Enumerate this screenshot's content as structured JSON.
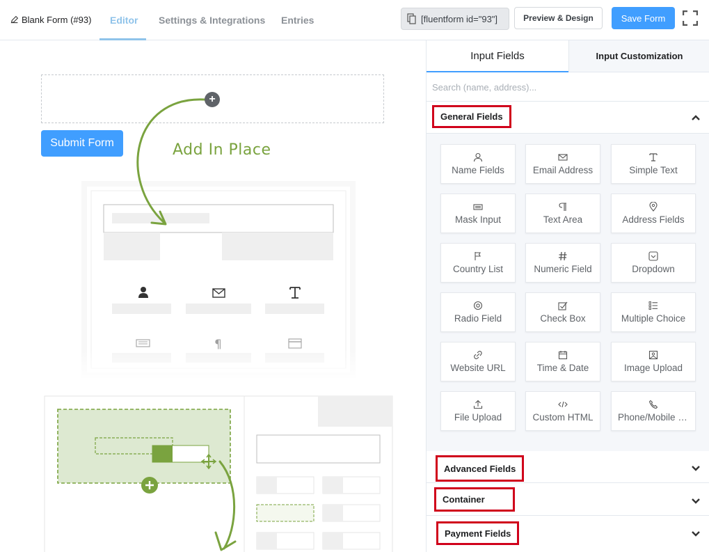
{
  "header": {
    "form_title": "Blank Form (#93)",
    "tabs": [
      "Editor",
      "Settings & Integrations",
      "Entries"
    ],
    "active_tab": "Editor",
    "shortcode": "[fluentform id=\"93\"]",
    "preview_label": "Preview & Design",
    "save_label": "Save Form"
  },
  "canvas": {
    "submit_label": "Submit Form",
    "hint_text": "Add In Place"
  },
  "panel": {
    "tabs": [
      "Input Fields",
      "Input Customization"
    ],
    "search_placeholder": "Search (name, address)...",
    "sections": {
      "general": "General Fields",
      "advanced": "Advanced Fields",
      "container": "Container",
      "payment": "Payment Fields"
    },
    "fields": [
      {
        "label": "Name Fields",
        "icon": "user-icon"
      },
      {
        "label": "Email Address",
        "icon": "envelope-icon"
      },
      {
        "label": "Simple Text",
        "icon": "text-icon"
      },
      {
        "label": "Mask Input",
        "icon": "keyboard-icon"
      },
      {
        "label": "Text Area",
        "icon": "paragraph-icon"
      },
      {
        "label": "Address Fields",
        "icon": "map-pin-icon"
      },
      {
        "label": "Country List",
        "icon": "flag-icon"
      },
      {
        "label": "Numeric Field",
        "icon": "hash-icon"
      },
      {
        "label": "Dropdown",
        "icon": "dropdown-icon"
      },
      {
        "label": "Radio Field",
        "icon": "radio-icon"
      },
      {
        "label": "Check Box",
        "icon": "checkbox-icon"
      },
      {
        "label": "Multiple Choice",
        "icon": "list-icon"
      },
      {
        "label": "Website URL",
        "icon": "link-icon"
      },
      {
        "label": "Time & Date",
        "icon": "calendar-icon"
      },
      {
        "label": "Image Upload",
        "icon": "image-icon"
      },
      {
        "label": "File Upload",
        "icon": "upload-icon"
      },
      {
        "label": "Custom HTML",
        "icon": "code-icon"
      },
      {
        "label": "Phone/Mobile Fi...",
        "icon": "phone-icon"
      }
    ]
  },
  "colors": {
    "primary": "#409eff",
    "accent_green": "#7aa33f",
    "highlight_red": "#d0021b",
    "active_tab": "#8fc3ea"
  }
}
